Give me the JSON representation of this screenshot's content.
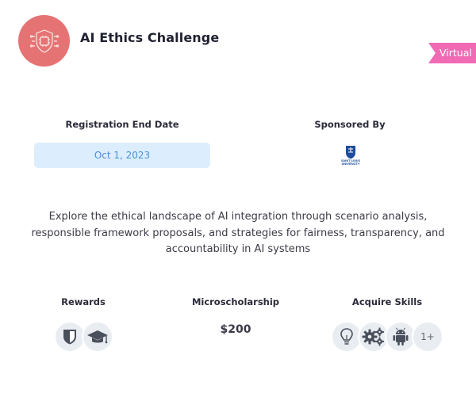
{
  "challenge": {
    "title": "AI Ethics Challenge",
    "badge": "Virtual",
    "logo_icon": "ai-chip-icon",
    "logo_color": "#e67373"
  },
  "registration": {
    "label": "Registration End Date",
    "date": "Oct 1, 2023"
  },
  "sponsor": {
    "label": "Sponsored By",
    "name": "SAINT LOUIS UNIVERSITY"
  },
  "description": "Explore the ethical landscape of AI integration through scenario analysis, responsible framework proposals, and strategies for fairness, transparency, and accountability in AI systems",
  "rewards": {
    "label": "Rewards",
    "icons": [
      "shield-badge-icon",
      "graduation-cap-icon"
    ]
  },
  "microscholarship": {
    "label": "Microscholarship",
    "amount": "$200"
  },
  "skills": {
    "label": "Acquire Skills",
    "icons": [
      "lightbulb-icon",
      "gears-icon",
      "android-icon"
    ],
    "more": "1+"
  },
  "colors": {
    "ribbon": "#f06ab4",
    "date_pill_bg": "#dceefd",
    "date_text": "#4a90d9",
    "icon_bubble": "#e9edf2"
  }
}
